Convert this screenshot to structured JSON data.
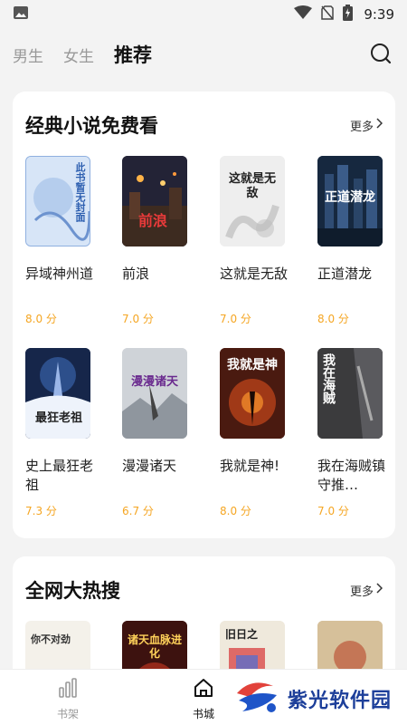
{
  "status_bar": {
    "time": "9:39"
  },
  "top_nav": {
    "tabs": [
      {
        "label": "男生"
      },
      {
        "label": "女生"
      },
      {
        "label": "推荐"
      }
    ]
  },
  "section1": {
    "title": "经典小说免费看",
    "more": "更多",
    "books": [
      {
        "title": "异域神州道",
        "score": "8.0 分",
        "cover_text": "此书暂无封面"
      },
      {
        "title": "前浪",
        "score": "7.0 分",
        "cover_text": "前浪"
      },
      {
        "title": "这就是无敌",
        "score": "7.0 分",
        "cover_text": "这就是无敌"
      },
      {
        "title": "正道潜龙",
        "score": "8.0 分",
        "cover_text": "正道潜龙"
      },
      {
        "title": "史上最狂老祖",
        "score": "7.3 分",
        "cover_text": "最狂老祖"
      },
      {
        "title": "漫漫诸天",
        "score": "6.7 分",
        "cover_text": "漫漫诸天"
      },
      {
        "title": "我就是神!",
        "score": "8.0 分",
        "cover_text": "我就是神"
      },
      {
        "title": "我在海贼镇守推…",
        "score": "7.0 分",
        "cover_text": "我在海贼"
      }
    ]
  },
  "section2": {
    "title": "全网大热搜",
    "more": "更多",
    "covers": [
      {
        "cover_text": "你不对劲"
      },
      {
        "cover_text": "诸天血脉进化"
      },
      {
        "cover_text": "旧日之"
      },
      {
        "cover_text": ""
      }
    ]
  },
  "bottom_nav": {
    "items": [
      {
        "label": "书架"
      },
      {
        "label": "书城"
      }
    ]
  },
  "watermark": {
    "text": "紫光软件园"
  },
  "colors": {
    "score": "#f5a623",
    "accent": "#111111",
    "inactive": "#999999"
  }
}
